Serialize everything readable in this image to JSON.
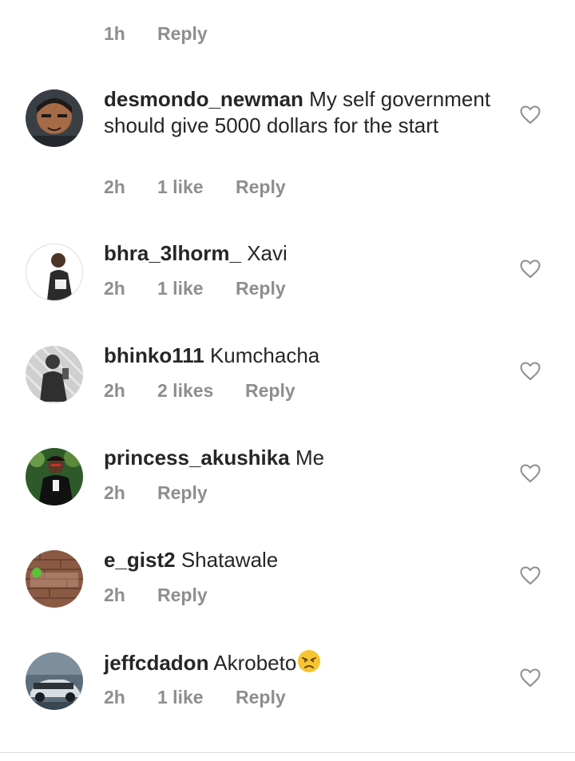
{
  "top_meta": {
    "time": "1h",
    "reply": "Reply"
  },
  "comments": [
    {
      "username": "desmondo_newman",
      "text": "My self government should give 5000 dollars for the start",
      "time": "2h",
      "likes": "1 like",
      "reply": "Reply"
    },
    {
      "username": "bhra_3lhorm_",
      "text": "Xavi",
      "time": "2h",
      "likes": "1 like",
      "reply": "Reply"
    },
    {
      "username": "bhinko111",
      "text": "Kumchacha",
      "time": "2h",
      "likes": "2 likes",
      "reply": "Reply"
    },
    {
      "username": "princess_akushika",
      "text": "Me",
      "time": "2h",
      "reply": "Reply"
    },
    {
      "username": "e_gist2",
      "text": "Shatawale",
      "time": "2h",
      "reply": "Reply"
    },
    {
      "username": "jeffcdadon",
      "text": "Akrobeto",
      "emoji": "persevering-face-emoji",
      "time": "2h",
      "likes": "1 like",
      "reply": "Reply"
    }
  ],
  "icons": {
    "like": "heart-outline-icon"
  },
  "colors": {
    "text": "#262626",
    "meta": "#8e8e8e",
    "divider": "#dbdbdb"
  }
}
